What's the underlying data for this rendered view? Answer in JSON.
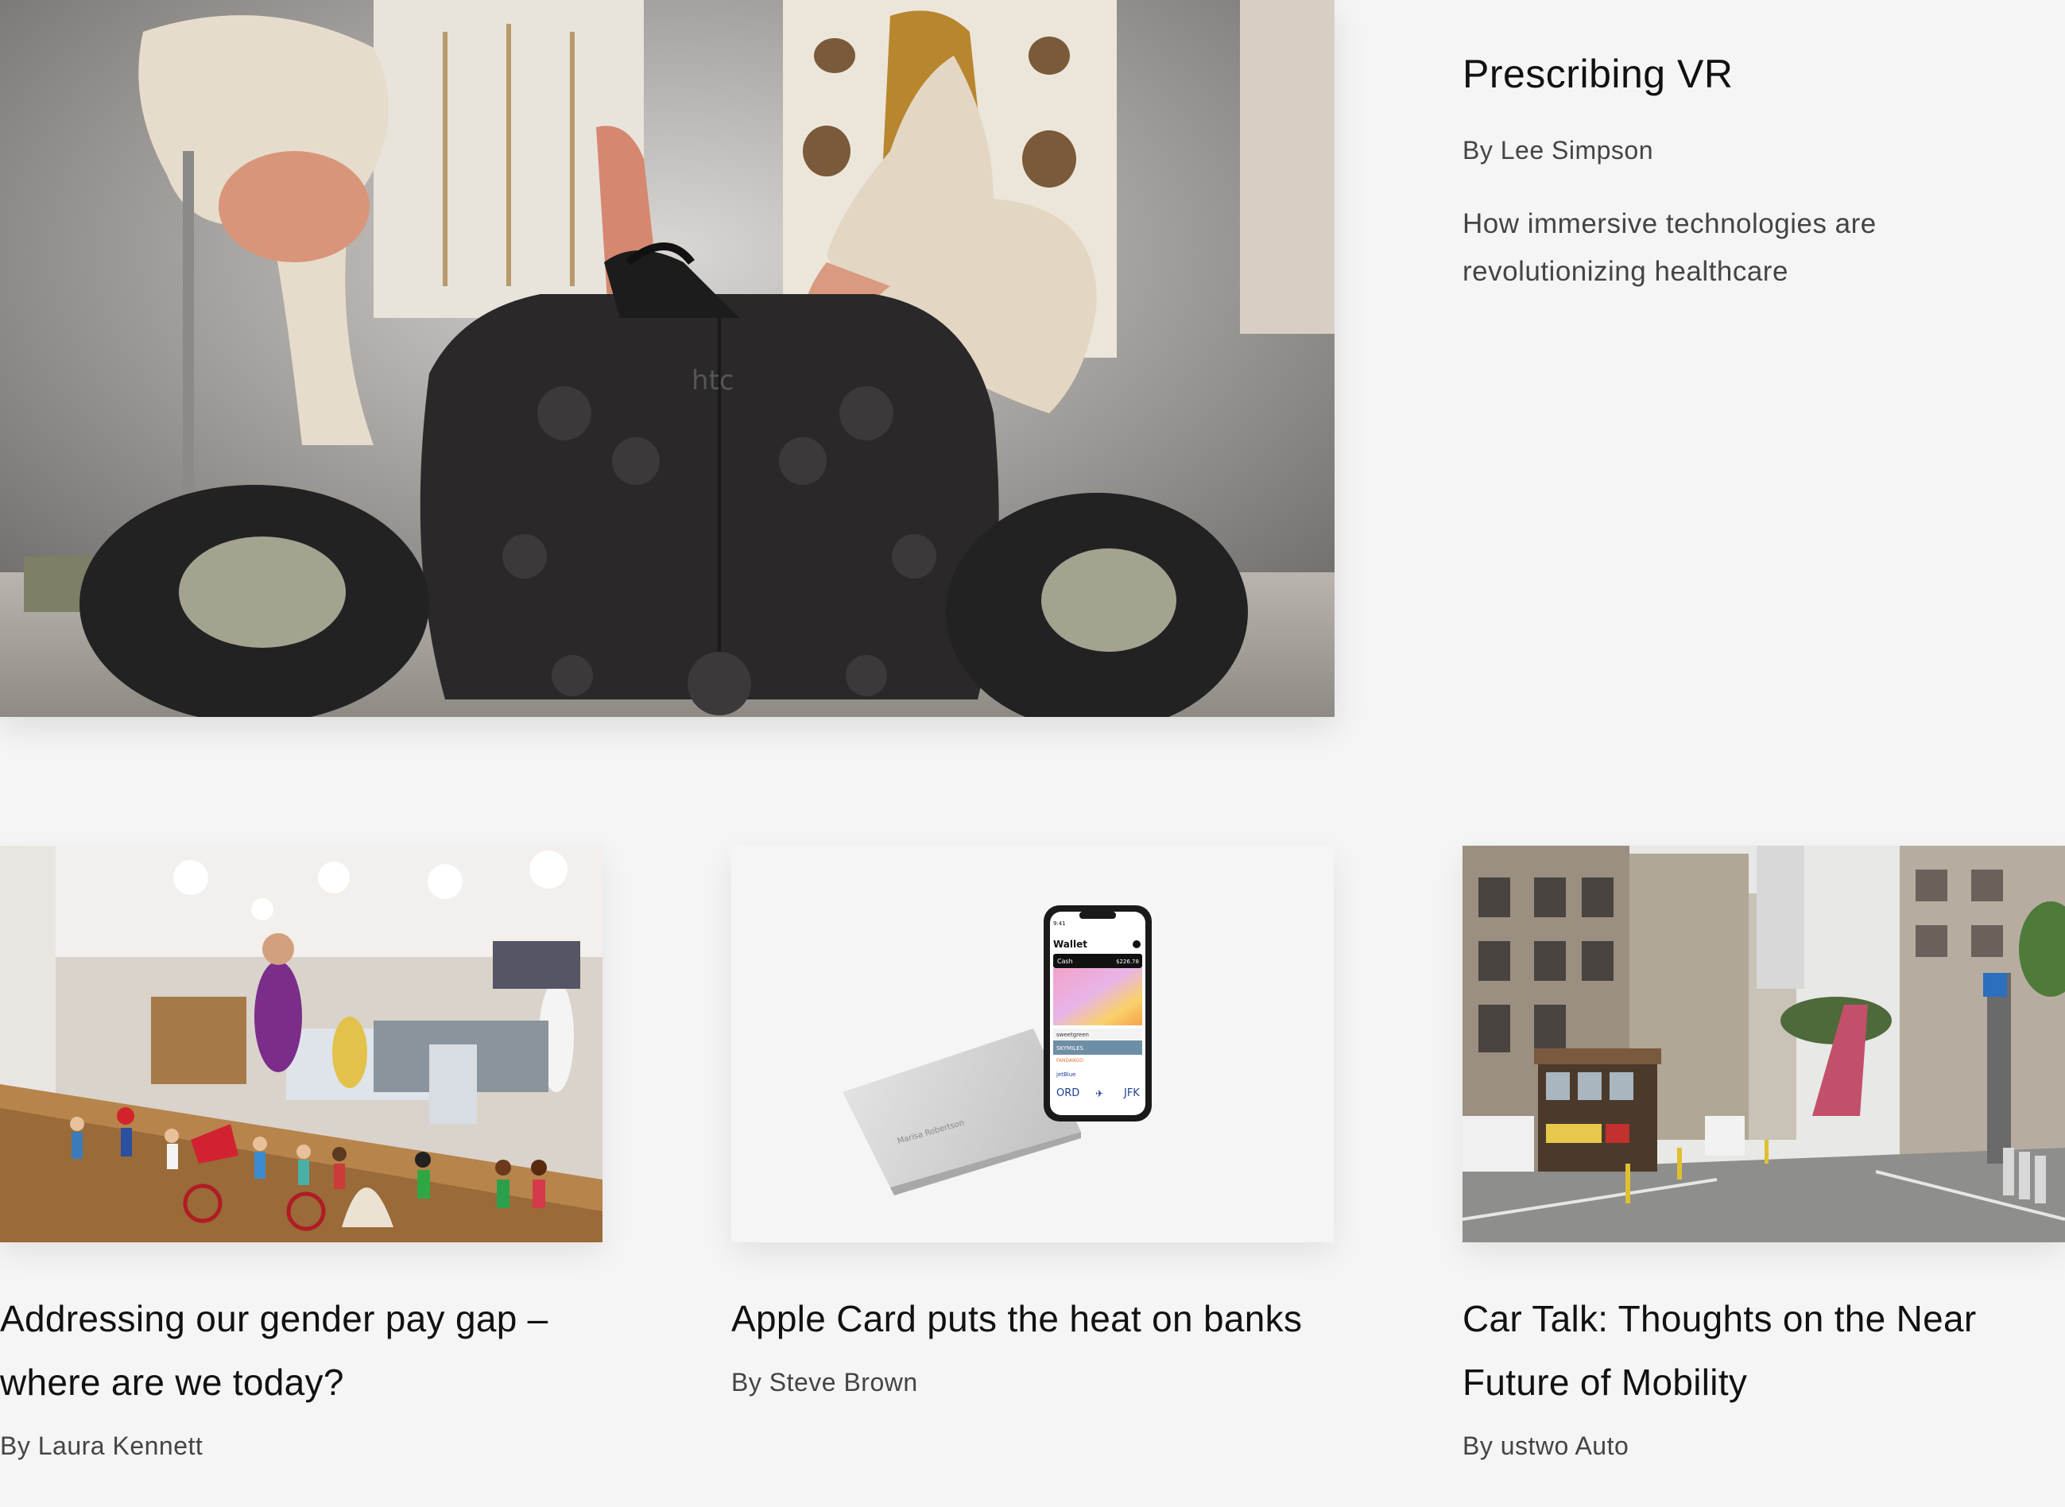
{
  "featured": {
    "title": "Prescribing VR",
    "author": "By Lee Simpson",
    "description": "How immersive technologies are revolutionizing healthcare",
    "image_alt": "VR headset and controllers in front of anatomy models",
    "headset_brand": "htc"
  },
  "cards": [
    {
      "title": "Addressing our gender pay gap – where are we today?",
      "author": "By Laura Kennett",
      "image_alt": "Toy figurines on a desk in an office"
    },
    {
      "title": "Apple Card puts the heat on banks",
      "author": "By Steve Brown",
      "image_alt": "Apple Card and iPhone showing Wallet",
      "phone": {
        "time": "9:41",
        "app": "Wallet",
        "card_label": "Cash",
        "balance": "$226.78",
        "pass1": "sweetgreen",
        "pass2": "SKYMILES",
        "pass3": "FANDANGO",
        "pass4": "jetBlue",
        "from": "ORD",
        "to": "JFK",
        "card_name": "Marisa Robertson"
      }
    },
    {
      "title": "Car Talk: Thoughts on the Near Future of Mobility",
      "author": "By ustwo Auto",
      "image_alt": "Cable car on a San Francisco street"
    }
  ]
}
